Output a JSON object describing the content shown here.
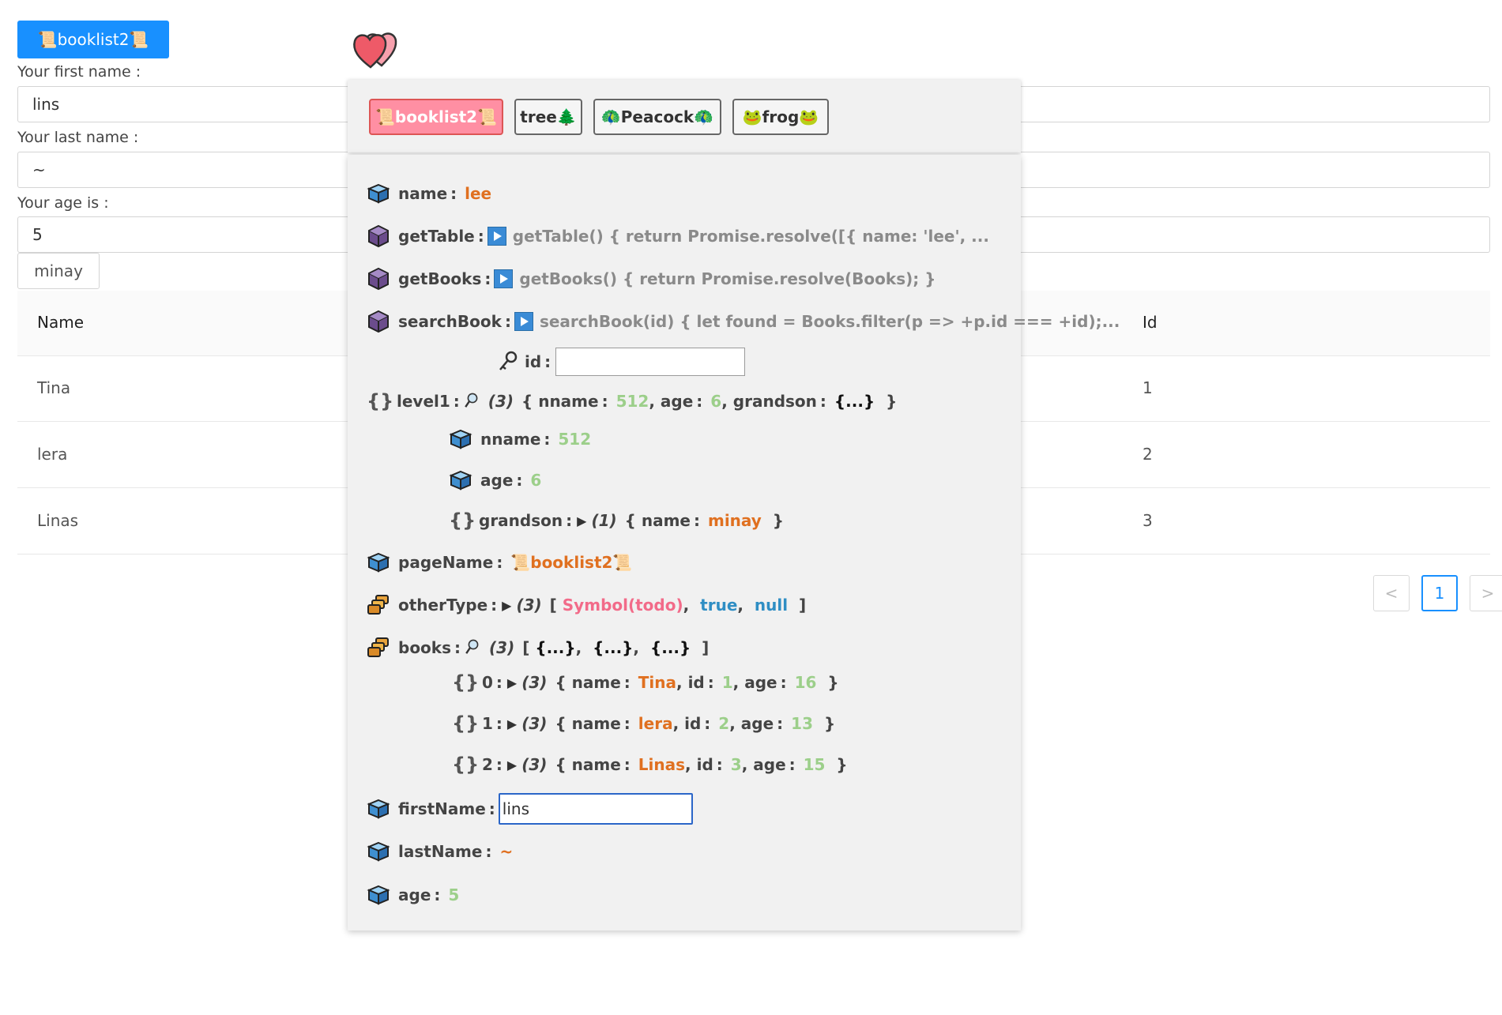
{
  "top_button": {
    "label": "📜booklist2📜"
  },
  "form": {
    "first_name_label": "Your first name :",
    "first_name_value": "lins",
    "last_name_label": "Your last name :",
    "last_name_value": "~",
    "age_label": "Your age is :",
    "age_value": "5",
    "minay_button": "minay"
  },
  "table": {
    "headers": [
      "Name",
      "Id"
    ],
    "rows": [
      {
        "name": "Tina",
        "id": "1"
      },
      {
        "name": "lera",
        "id": "2"
      },
      {
        "name": "Linas",
        "id": "3"
      }
    ]
  },
  "pagination": {
    "prev": "<",
    "current": "1",
    "next": ">"
  },
  "panel": {
    "tabs": [
      "📜booklist2📜",
      "tree🌲",
      "🦚Peacock🦚",
      "🐸frog🐸"
    ],
    "fields": {
      "name_key": "name",
      "name_value": "lee",
      "getTable_key": "getTable",
      "getTable_value": "getTable() { return Promise.resolve([{ name: 'lee', ...",
      "getBooks_key": "getBooks",
      "getBooks_value": "getBooks() { return Promise.resolve(Books); }",
      "searchBook_key": "searchBook",
      "searchBook_value": "searchBook(id) { let found = Books.filter(p => +p.id === +id);...",
      "id_param": "id",
      "level1_key": "level1",
      "level1_count": "(3)",
      "level1_nname_k": "nname",
      "level1_nname_v": "512",
      "level1_age_k": "age",
      "level1_age_v": "6",
      "level1_grandson_k": "grandson",
      "level1_grandson_v": "{...}",
      "nname_key": "nname",
      "nname_value": "512",
      "age_key_inner": "age",
      "age_value_inner": "6",
      "grandson_key": "grandson",
      "grandson_count": "(1)",
      "grandson_name_k": "name",
      "grandson_name_v": "minay",
      "pageName_key": "pageName",
      "pageName_value": "📜booklist2📜",
      "otherType_key": "otherType",
      "otherType_count": "(3)",
      "otherType_sym": "Symbol(todo)",
      "otherType_bool": "true",
      "otherType_null": "null",
      "books_key": "books",
      "books_count": "(3)",
      "books_item": "{...}",
      "firstName_key": "firstName",
      "firstName_value": "lins",
      "lastName_key": "lastName",
      "lastName_value": "~",
      "age_key": "age",
      "age_value": "5"
    },
    "books": [
      {
        "index": "0",
        "count": "(3)",
        "name": "Tina",
        "id": "1",
        "age": "16"
      },
      {
        "index": "1",
        "count": "(3)",
        "name": "lera",
        "id": "2",
        "age": "13"
      },
      {
        "index": "2",
        "count": "(3)",
        "name": "Linas",
        "id": "3",
        "age": "15"
      }
    ],
    "labels": {
      "name": "name",
      "id": "id",
      "age": "age"
    }
  },
  "colors": {
    "accent": "#1890ff",
    "active_tab": "#ff8fa3",
    "string": "#e07020",
    "number": "#9ccf8a"
  }
}
